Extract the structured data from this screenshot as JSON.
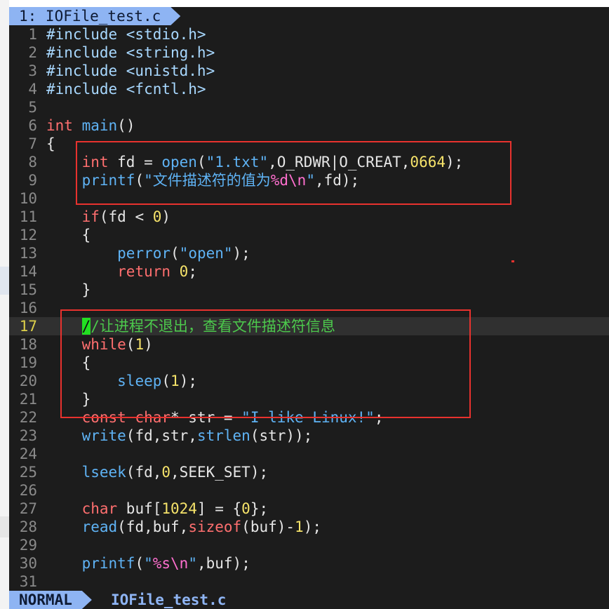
{
  "tab": {
    "label": "1: IOFile_test.c"
  },
  "editor": {
    "lines": [
      {
        "n": "1",
        "segs": [
          [
            "inc",
            "#include <stdio.h>"
          ]
        ]
      },
      {
        "n": "2",
        "segs": [
          [
            "inc",
            "#include <string.h>"
          ]
        ]
      },
      {
        "n": "3",
        "segs": [
          [
            "inc",
            "#include <unistd.h>"
          ]
        ]
      },
      {
        "n": "4",
        "segs": [
          [
            "inc",
            "#include <fcntl.h>"
          ]
        ]
      },
      {
        "n": "5",
        "segs": []
      },
      {
        "n": "6",
        "segs": [
          [
            "kw",
            "int"
          ],
          [
            "",
            " "
          ],
          [
            "fn",
            "main"
          ],
          [
            "",
            "()"
          ]
        ]
      },
      {
        "n": "7",
        "segs": [
          [
            "",
            "{"
          ]
        ]
      },
      {
        "n": "8",
        "segs": [
          [
            "",
            "    "
          ],
          [
            "kw",
            "int"
          ],
          [
            "",
            " fd = "
          ],
          [
            "fn",
            "open"
          ],
          [
            "",
            "("
          ],
          [
            "str",
            "\"1.txt\""
          ],
          [
            "",
            ",O_RDWR|O_CREAT,"
          ],
          [
            "num",
            "0664"
          ],
          [
            "",
            ");"
          ]
        ]
      },
      {
        "n": "9",
        "segs": [
          [
            "",
            "    "
          ],
          [
            "fn",
            "printf"
          ],
          [
            "",
            "("
          ],
          [
            "str",
            "\"文件描述符的值为"
          ],
          [
            "esc",
            "%d\\n"
          ],
          [
            "str",
            "\""
          ],
          [
            "",
            ",fd);"
          ]
        ]
      },
      {
        "n": "10",
        "segs": []
      },
      {
        "n": "11",
        "segs": [
          [
            "",
            "    "
          ],
          [
            "kw",
            "if"
          ],
          [
            "",
            "(fd < "
          ],
          [
            "num",
            "0"
          ],
          [
            "",
            ")"
          ]
        ]
      },
      {
        "n": "12",
        "segs": [
          [
            "",
            "    {"
          ]
        ]
      },
      {
        "n": "13",
        "segs": [
          [
            "",
            "        "
          ],
          [
            "fn",
            "perror"
          ],
          [
            "",
            "("
          ],
          [
            "str",
            "\"open\""
          ],
          [
            "",
            ");"
          ]
        ]
      },
      {
        "n": "14",
        "segs": [
          [
            "",
            "        "
          ],
          [
            "kw",
            "return"
          ],
          [
            "",
            " "
          ],
          [
            "num",
            "0"
          ],
          [
            "",
            ";"
          ]
        ]
      },
      {
        "n": "15",
        "segs": [
          [
            "",
            "    }"
          ]
        ]
      },
      {
        "n": "16",
        "segs": []
      },
      {
        "n": "17",
        "cursorline": true,
        "segs": [
          [
            "",
            "    "
          ],
          [
            "cur",
            "/"
          ],
          [
            "cm",
            "/让进程不退出，查看文件描述符信息"
          ]
        ]
      },
      {
        "n": "18",
        "segs": [
          [
            "",
            "    "
          ],
          [
            "kw",
            "while"
          ],
          [
            "",
            "("
          ],
          [
            "num",
            "1"
          ],
          [
            "",
            ")"
          ]
        ]
      },
      {
        "n": "19",
        "segs": [
          [
            "",
            "    {"
          ]
        ]
      },
      {
        "n": "20",
        "segs": [
          [
            "",
            "        "
          ],
          [
            "fn",
            "sleep"
          ],
          [
            "",
            "("
          ],
          [
            "num",
            "1"
          ],
          [
            "",
            ");"
          ]
        ]
      },
      {
        "n": "21",
        "segs": [
          [
            "",
            "    }"
          ]
        ]
      },
      {
        "n": "22",
        "segs": [
          [
            "",
            "    "
          ],
          [
            "kw",
            "const char"
          ],
          [
            "",
            "* str = "
          ],
          [
            "str",
            "\"I like Linux!\""
          ],
          [
            "",
            ";"
          ]
        ]
      },
      {
        "n": "23",
        "segs": [
          [
            "",
            "    "
          ],
          [
            "fn",
            "write"
          ],
          [
            "",
            "(fd,str,"
          ],
          [
            "fn",
            "strlen"
          ],
          [
            "",
            "(str));"
          ]
        ]
      },
      {
        "n": "24",
        "segs": []
      },
      {
        "n": "25",
        "segs": [
          [
            "",
            "    "
          ],
          [
            "fn",
            "lseek"
          ],
          [
            "",
            "(fd,"
          ],
          [
            "num",
            "0"
          ],
          [
            "",
            ",SEEK_SET);"
          ]
        ]
      },
      {
        "n": "26",
        "segs": []
      },
      {
        "n": "27",
        "segs": [
          [
            "",
            "    "
          ],
          [
            "kw",
            "char"
          ],
          [
            "",
            " buf["
          ],
          [
            "num",
            "1024"
          ],
          [
            "",
            "] = {"
          ],
          [
            "num",
            "0"
          ],
          [
            "",
            "};"
          ]
        ]
      },
      {
        "n": "28",
        "segs": [
          [
            "",
            "    "
          ],
          [
            "fn",
            "read"
          ],
          [
            "",
            "(fd,buf,"
          ],
          [
            "kw",
            "sizeof"
          ],
          [
            "",
            "(buf)-"
          ],
          [
            "num",
            "1"
          ],
          [
            "",
            ");"
          ]
        ]
      },
      {
        "n": "29",
        "segs": []
      },
      {
        "n": "30",
        "segs": [
          [
            "",
            "    "
          ],
          [
            "fn",
            "printf"
          ],
          [
            "",
            "("
          ],
          [
            "str",
            "\""
          ],
          [
            "esc",
            "%s\\n"
          ],
          [
            "str",
            "\""
          ],
          [
            "",
            ",buf);"
          ]
        ]
      },
      {
        "n": "31",
        "segs": []
      }
    ]
  },
  "statusline": {
    "mode": "NORMAL",
    "filename": "IOFile_test.c"
  },
  "colors": {
    "background": "#1c1c1c",
    "keyword": "#ff6f6f",
    "function": "#5fb3f5",
    "number": "#f6e36a",
    "comment": "#4cc94c",
    "annotation_box": "#e8322e",
    "tab_accent": "#8eb4f3"
  }
}
